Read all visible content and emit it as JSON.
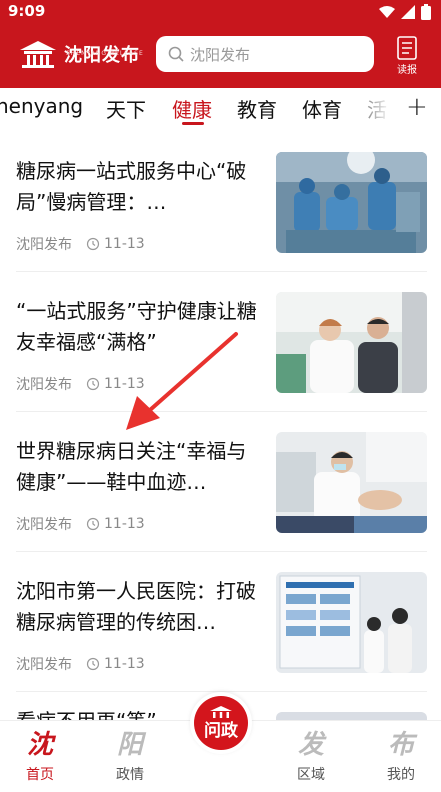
{
  "status_bar": {
    "time": "9:09"
  },
  "header": {
    "logo_text": "沈阳发布",
    "logo_subtext": "SHENYANG RELEASE",
    "search_placeholder": "沈阳发布",
    "read_label": "读报"
  },
  "tabs": [
    {
      "label": "henyang",
      "active": false
    },
    {
      "label": "天下",
      "active": false
    },
    {
      "label": "健康",
      "active": true
    },
    {
      "label": "教育",
      "active": false
    },
    {
      "label": "体育",
      "active": false
    },
    {
      "label": "活",
      "active": false
    }
  ],
  "tab_add_label": "+",
  "news": [
    {
      "title": "糖尿病一站式服务中心“破局”慢病管理：…",
      "source": "沈阳发布",
      "date": "11-13",
      "image": "surgery-photo"
    },
    {
      "title": "“一站式服务”守护健康让糖友幸福感“满格”",
      "source": "沈阳发布",
      "date": "11-13",
      "image": "doctor-patient-photo"
    },
    {
      "title": "世界糖尿病日关注“幸福与健康”——鞋中血迹…",
      "source": "沈阳发布",
      "date": "11-13",
      "image": "foot-exam-photo"
    },
    {
      "title": "沈阳市第一人民医院：打破糖尿病管理的传统困…",
      "source": "沈阳发布",
      "date": "11-13",
      "image": "poster-board-photo"
    }
  ],
  "partial_title": "看病不用再“等”",
  "bottom_nav": [
    {
      "glyph": "沈",
      "label": "首页",
      "active": true
    },
    {
      "glyph": "阳",
      "label": "政情",
      "active": false
    },
    {
      "glyph": "发",
      "label": "区域",
      "active": false
    },
    {
      "glyph": "布",
      "label": "我的",
      "active": false
    }
  ],
  "center_button": {
    "label": "问政"
  },
  "colors": {
    "brand_red": "#c8161d",
    "meta_gray": "#888888"
  }
}
